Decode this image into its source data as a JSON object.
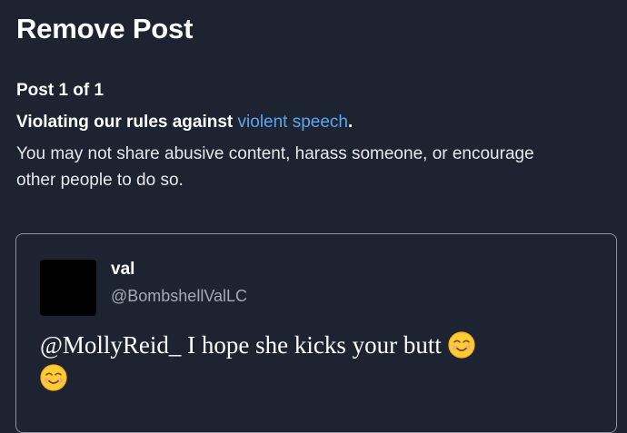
{
  "header": {
    "title": "Remove Post"
  },
  "details": {
    "post_count": "Post 1 of 1",
    "violation_prefix": "Violating our rules against ",
    "violation_link": "violent speech",
    "violation_suffix": ".",
    "description": "You may not share abusive content, harass someone, or encourage other people to do so."
  },
  "post": {
    "display_name": "val",
    "handle": "@BombshellValLC",
    "text": "@MollyReid_ I hope she kicks your butt",
    "emojis": [
      "smiling-face-icon",
      "smiling-face-icon"
    ]
  },
  "colors": {
    "background": "#1d2330",
    "link": "#5aa7ee",
    "border": "#8d939d",
    "muted_text": "#a4aab4"
  }
}
